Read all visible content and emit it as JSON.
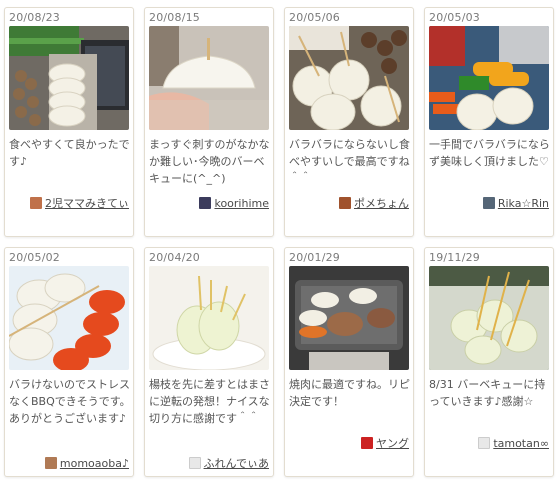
{
  "cards": [
    {
      "date": "20/08/23",
      "text": "食べやすくて良かったです♪",
      "user": "2児ママみきてぃ",
      "avatar_color": "#c0714a"
    },
    {
      "date": "20/08/15",
      "text": "まっすぐ刺すのがなかなか難しい･今晩のバーベキューに(^_^)",
      "user": "koorihime",
      "avatar_color": "#3b3b5c"
    },
    {
      "date": "20/05/06",
      "text": "バラバラにならないし食べやすいしで最高ですね＾＾",
      "user": "ポメちょん",
      "avatar_color": "#a0522d"
    },
    {
      "date": "20/05/03",
      "text": "一手間でバラバラにならず美味しく頂けました♡",
      "user": "Rika☆Rin",
      "avatar_color": "#556677"
    },
    {
      "date": "20/05/02",
      "text": "バラけないのでストレスなくBBQできそうです。ありがとうございます♪",
      "user": "momoaoba♪",
      "avatar_color": "#b07a55"
    },
    {
      "date": "20/04/20",
      "text": "楊枝を先に差すとはまさに逆転の発想！ナイスな切り方に感謝です＾＾",
      "user": "ふれんでぃあ",
      "avatar_color": "#e8e8e8"
    },
    {
      "date": "20/01/29",
      "text": "焼肉に最適ですね。リピ決定です！",
      "user": "ヤング",
      "avatar_color": "#cc2222"
    },
    {
      "date": "19/11/29",
      "text": "8/31 バーベキューに持っていきます♪感謝☆",
      "user": "tamotan∞",
      "avatar_color": "#e8e8e8"
    }
  ]
}
